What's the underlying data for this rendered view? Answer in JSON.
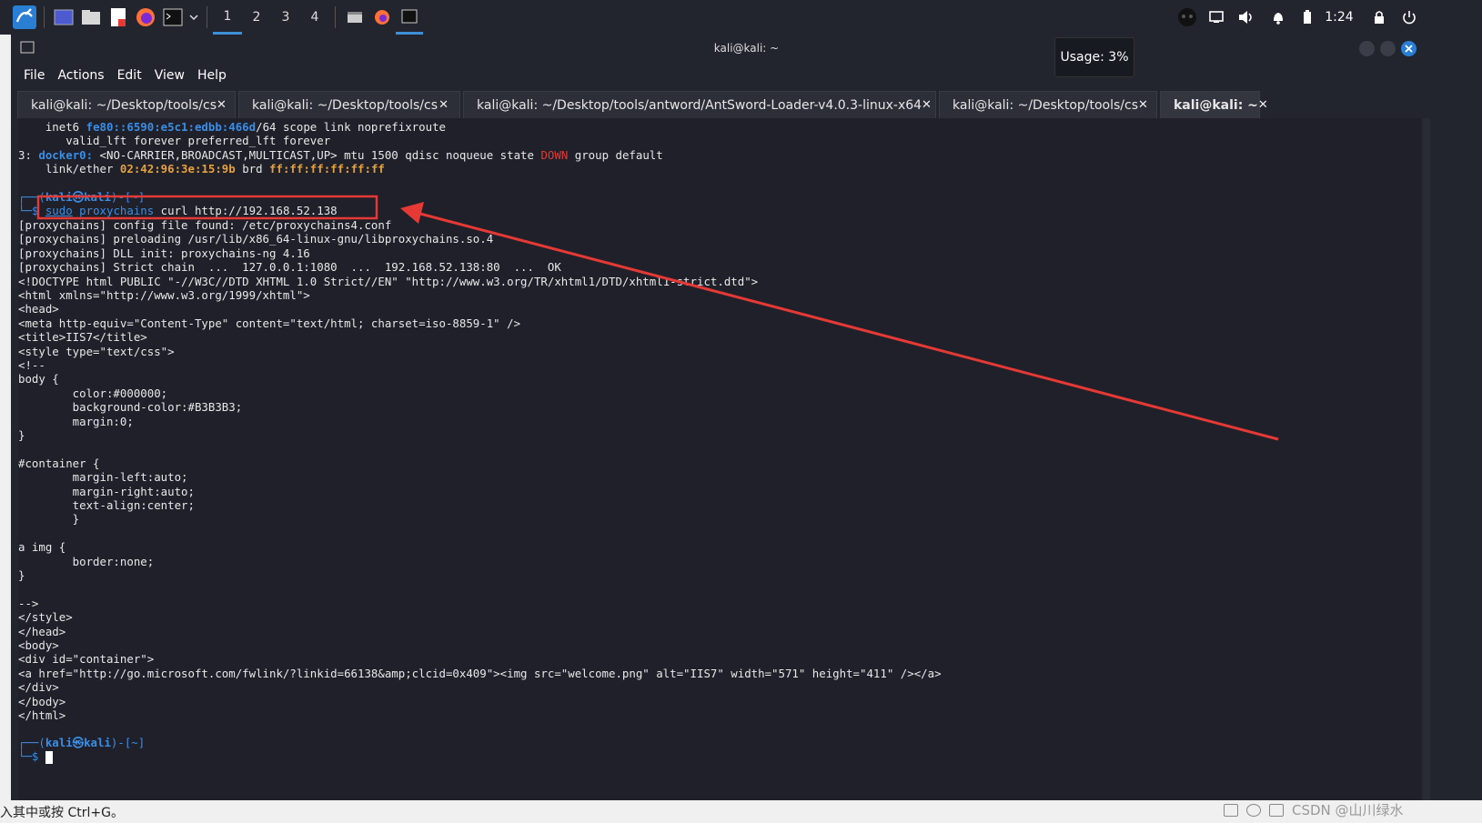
{
  "panel": {
    "workspaces": [
      "1",
      "2",
      "3",
      "4"
    ],
    "clock": "1:24",
    "usage_tooltip": "Usage: 3%"
  },
  "window": {
    "title": "kali@kali: ~",
    "menu": [
      "File",
      "Actions",
      "Edit",
      "View",
      "Help"
    ],
    "tabs": [
      {
        "label": "kali@kali: ~/Desktop/tools/cs"
      },
      {
        "label": "kali@kali: ~/Desktop/tools/cs"
      },
      {
        "label": "kali@kali: ~/Desktop/tools/antword/AntSword-Loader-v4.0.3-linux-x64"
      },
      {
        "label": "kali@kali: ~/Desktop/tools/cs"
      },
      {
        "label": "kali@kali: ~"
      }
    ],
    "tab_close": "✕"
  },
  "terminal": {
    "l1": {
      "a": "    inet6 ",
      "b": "fe80::6590:e5c1:edbb:466d",
      "c": "/64 scope link noprefixroute"
    },
    "l2": "       valid_lft forever preferred_lft forever",
    "l3": {
      "a": "3: ",
      "b": "docker0:",
      "c": " <NO-CARRIER,BROADCAST,MULTICAST,UP> mtu 1500 qdisc noqueue state ",
      "d": "DOWN",
      "e": " group default"
    },
    "l4": {
      "a": "    link/ether ",
      "b": "02:42:96:3e:15:9b",
      "c": " brd ",
      "d": "ff:ff:ff:ff:ff:ff"
    },
    "prompt1": {
      "a": "┌──(",
      "b": "kali㉿kali",
      "c": ")-[~]"
    },
    "cmd": {
      "a": "└─$ ",
      "b": "sudo",
      "c": " proxychains",
      "d": " curl http://192.168.52.138"
    },
    "out": [
      "[proxychains] config file found: /etc/proxychains4.conf",
      "[proxychains] preloading /usr/lib/x86_64-linux-gnu/libproxychains.so.4",
      "[proxychains] DLL init: proxychains-ng 4.16",
      "[proxychains] Strict chain  ...  127.0.0.1:1080  ...  192.168.52.138:80  ...  OK",
      "<!DOCTYPE html PUBLIC \"-//W3C//DTD XHTML 1.0 Strict//EN\" \"http://www.w3.org/TR/xhtml1/DTD/xhtml1-strict.dtd\">",
      "<html xmlns=\"http://www.w3.org/1999/xhtml\">",
      "<head>",
      "<meta http-equiv=\"Content-Type\" content=\"text/html; charset=iso-8859-1\" />",
      "<title>IIS7</title>",
      "<style type=\"text/css\">",
      "<!--",
      "body {",
      "        color:#000000;",
      "        background-color:#B3B3B3;",
      "        margin:0;",
      "}",
      "",
      "#container {",
      "        margin-left:auto;",
      "        margin-right:auto;",
      "        text-align:center;",
      "        }",
      "",
      "a img {",
      "        border:none;",
      "}",
      "",
      "-->",
      "</style>",
      "</head>",
      "<body>",
      "<div id=\"container\">",
      "<a href=\"http://go.microsoft.com/fwlink/?linkid=66138&amp;clcid=0x409\"><img src=\"welcome.png\" alt=\"IIS7\" width=\"571\" height=\"411\" /></a>",
      "</div>",
      "</body>",
      "</html>"
    ],
    "prompt2": {
      "a": "┌──(",
      "b": "kali㉿kali",
      "c": ")-[~]"
    },
    "prompt2_cmd": "└─$ "
  },
  "statusbar": {
    "hint": "入其中或按 Ctrl+G。",
    "watermark": "CSDN @山川绿水"
  },
  "colors": {
    "panel_bg": "#23252e",
    "terminal_bg": "#1f2029",
    "accent_blue": "#3a8ee6",
    "annotation_red": "#e53935",
    "hex_orange": "#e6a23c"
  },
  "icons": [
    "kali-menu-icon",
    "desktop-icon",
    "file-manager-icon",
    "text-editor-icon",
    "firefox-icon",
    "terminal-icon",
    "dropdown-icon",
    "show-desktop-icon",
    "mask-icon",
    "screen-icon",
    "volume-icon",
    "bell-icon",
    "battery-icon",
    "lock-icon",
    "power-icon"
  ]
}
